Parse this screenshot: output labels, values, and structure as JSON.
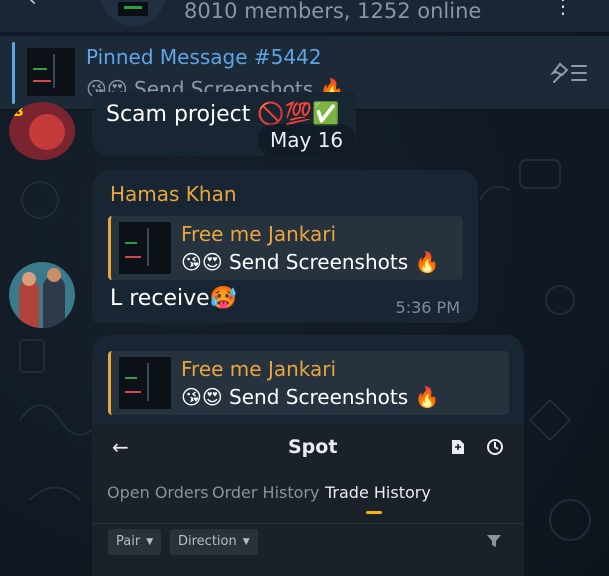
{
  "header": {
    "members_text": "8010 members, 1252 online"
  },
  "pinned": {
    "title": "Pinned Message #5442",
    "preview": "😘😍 Send Screenshots 🔥",
    "action_icon": "unpin-list-icon"
  },
  "messages": [
    {
      "text": "Scam project 🚫💯✅",
      "date_chip": "May 16"
    },
    {
      "sender": "Hamas Khan",
      "reply_title": "Free me Jankari",
      "reply_text": "😘😍  Send Screenshots 🔥",
      "text": "L receive🥵",
      "time": "5:36 PM"
    },
    {
      "reply_title": "Free me Jankari",
      "reply_text": "😘😍  Send Screenshots 🔥",
      "screenshot": {
        "back": "←",
        "title": "Spot",
        "tabs": [
          "Open Orders",
          "Order History",
          "Trade History"
        ],
        "active_tab": "Trade History",
        "filters": [
          "Pair",
          "Direction"
        ]
      }
    }
  ],
  "colors": {
    "accent_link": "#5ea4e6",
    "sender_name": "#e8a63c",
    "bubble": "#182533",
    "exchange_accent": "#f0b90b"
  }
}
